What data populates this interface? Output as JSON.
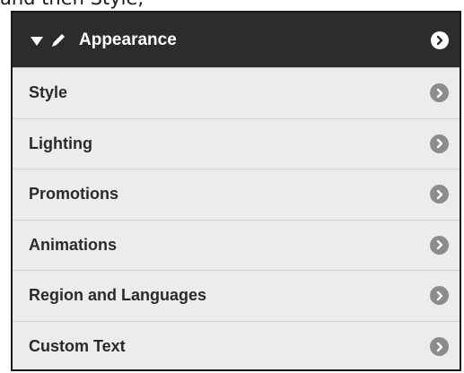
{
  "caption": "and then Style,",
  "panel": {
    "header": {
      "title": "Appearance",
      "expand_icon": "triangle-down-icon",
      "pencil_icon": "pencil-icon",
      "chevron_icon": "chevron-right-icon"
    },
    "items": [
      {
        "label": "Style"
      },
      {
        "label": "Lighting"
      },
      {
        "label": "Promotions"
      },
      {
        "label": "Animations"
      },
      {
        "label": "Region and Languages"
      },
      {
        "label": "Custom Text"
      }
    ]
  },
  "colors": {
    "header_bg": "#2c2c2c",
    "row_bg": "#ececec",
    "chevron": "#8c8c8c"
  }
}
